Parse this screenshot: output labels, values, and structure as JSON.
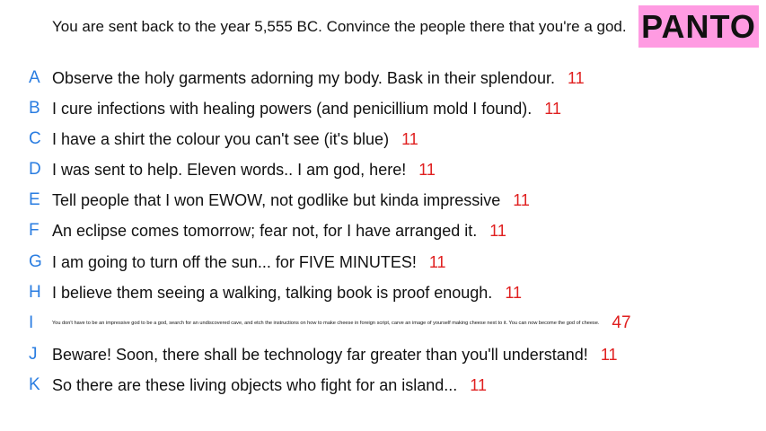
{
  "prompt": "You are sent back to the year 5,555 BC. Convince the people there that you're a god.",
  "brand": {
    "label": "PANTO",
    "background": "#ff9be2"
  },
  "colors": {
    "letter": "#2a7de1",
    "count": "#e02020",
    "text": "#111111"
  },
  "entries": [
    {
      "letter": "A",
      "text": "Observe the holy garments adorning my body. Bask in their splendour.",
      "count": "11"
    },
    {
      "letter": "B",
      "text": "I cure infections with healing powers (and penicillium mold I found).",
      "count": "11"
    },
    {
      "letter": "C",
      "text": "I have a shirt the colour you can't see (it's blue)",
      "count": "11"
    },
    {
      "letter": "D",
      "text": "I was sent to help. Eleven words.. I am god, here!",
      "count": "11"
    },
    {
      "letter": "E",
      "text": "Tell people that I won EWOW, not godlike but kinda impressive",
      "count": "11"
    },
    {
      "letter": "F",
      "text": "An eclipse comes tomorrow; fear not, for I have arranged it.",
      "count": "11"
    },
    {
      "letter": "G",
      "text": "I am going to turn off the sun... for FIVE MINUTES!",
      "count": "11"
    },
    {
      "letter": "H",
      "text": "I believe them seeing a walking, talking book is proof enough.",
      "count": "11"
    },
    {
      "letter": "I",
      "text": "You don't have to be an impressive god to be a god, search for an undiscovered cave, and etch the instructions on how to make cheese in foreign script, carve an image of yourself making cheese next to it. You can now become the god of cheese.",
      "count": "47"
    },
    {
      "letter": "J",
      "text": "Beware! Soon, there shall be technology far greater than you'll understand!",
      "count": "11"
    },
    {
      "letter": "K",
      "text": "So there are these living objects who fight for an island...",
      "count": "11"
    }
  ]
}
